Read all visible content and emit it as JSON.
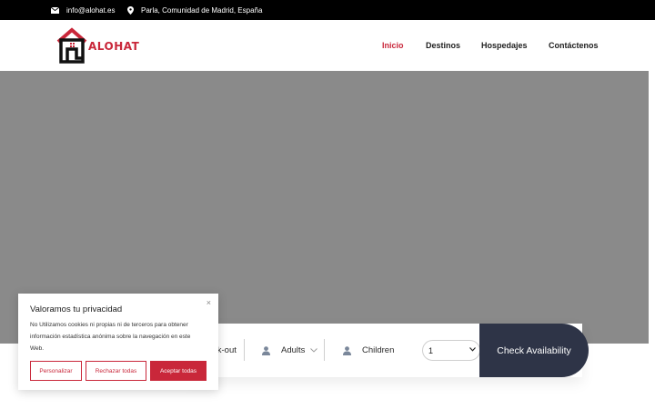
{
  "topbar": {
    "email": "info@alohat.es",
    "location": "Parla, Comunidad de Madrid, España"
  },
  "brand": {
    "name": "ALOHAT",
    "color": "#c9273a"
  },
  "nav": {
    "inicio": "Inicio",
    "destinos": "Destinos",
    "hospedajes": "Hospedajes",
    "contactenos": "Contáctenos"
  },
  "booking": {
    "checkout_label": "ck-out",
    "adults_label": "Adults",
    "children_label": "Children",
    "children_selected": "1",
    "check_button": "Check Availability"
  },
  "cookie": {
    "title": "Valoramos tu privacidad",
    "text": "No Utilizamos cookies ni propias ni de terceros para obtener información estadística anónima sobre la navegación en este Web.",
    "close": "×",
    "personalize": "Personalizar",
    "reject_all": "Rechazar todas",
    "accept_all": "Aceptar todas"
  },
  "colors": {
    "accent": "#c9273a",
    "dark": "#2e3447",
    "hero": "#8a8a8a"
  }
}
